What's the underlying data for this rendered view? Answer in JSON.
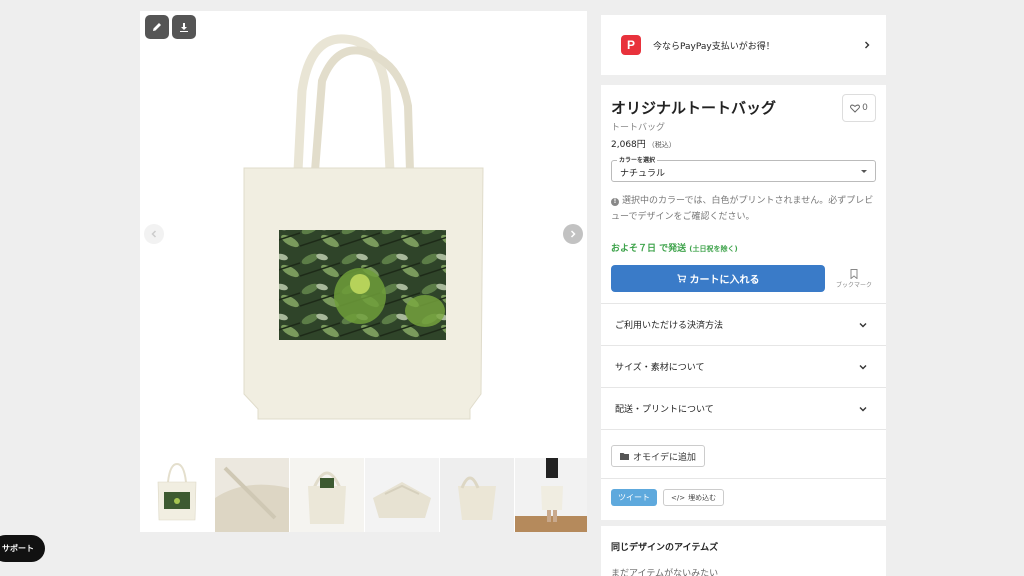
{
  "gallery": {
    "edit_icon": "pencil-icon",
    "download_icon": "download-icon",
    "prev_icon": "chevron-left-icon",
    "next_icon": "chevron-right-icon",
    "thumbnail_count": 6
  },
  "support": {
    "label": "サポート"
  },
  "paypay": {
    "logo_text": "P",
    "text": "今ならPayPay支払いがお得！"
  },
  "product": {
    "title": "オリジナルトートバッグ",
    "favorite_count": "0",
    "subtitle": "トートバッグ",
    "price": "2,068円",
    "price_note": "（税込）",
    "color_select": {
      "legend": "カラーを選択",
      "value": "ナチュラル"
    },
    "notice": "選択中のカラーでは、白色がプリントされません。必ずプレビューでデザインをご確認ください。",
    "shipping": "およそ７日 で発送",
    "shipping_note": "(土日祝を除く)",
    "cart_button": "カートに入れる",
    "bookmark_label": "ブックマーク",
    "accordions": [
      {
        "label": "ご利用いただける決済方法"
      },
      {
        "label": "サイズ・素材について"
      },
      {
        "label": "配送・プリントについて"
      }
    ],
    "omoide_button": "オモイデに追加",
    "tweet_button": "ツイート",
    "embed_button": "埋め込む"
  },
  "same_design": {
    "title": "同じデザインのアイテムズ",
    "empty": "まだアイテムがないみたい"
  },
  "colors": {
    "accent_blue": "#3a7bc8",
    "ship_green": "#3ea34b",
    "paypay_red": "#e8323c",
    "tweet_blue": "#5ea9dd",
    "bag_natural": "#f1eee1"
  }
}
